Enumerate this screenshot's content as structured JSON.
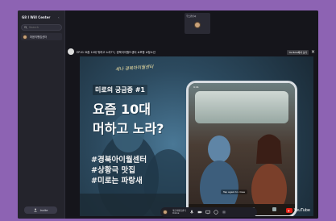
{
  "sidebar": {
    "title": "G8 I Will Center",
    "collapse_icon": "chevron-left-icon",
    "search_placeholder": "Search",
    "room_label": "마음의빵집센터",
    "invite_label": "Invite"
  },
  "tile": {
    "name": "주스만난씨"
  },
  "youtube": {
    "title": "EP.01 요즘 10대 뭐하고 노라?? | 경북아이월드센터 #포항 #청소년",
    "chip": "YouTube에서 보기",
    "close_icon": "close-icon"
  },
  "video": {
    "logo": "세나 경북아이월센터",
    "question": "미로의 궁금증 #1",
    "headline_1": "요즘 10대",
    "headline_2": "머하고 노라?",
    "tags": [
      "#경북아이월센터",
      "#상황극 맛집",
      "#미로는 파랑새"
    ],
    "phone_status": "9:41",
    "phone_bubble": "Tap again to close",
    "youtube_brand": "YouTube"
  },
  "toolbar": {
    "user_name": "마음의빵집센터",
    "user_sub": "Online"
  },
  "colors": {
    "background": "#8d63b3",
    "frame": "#1b1b22",
    "youtube_red": "#e62117"
  }
}
